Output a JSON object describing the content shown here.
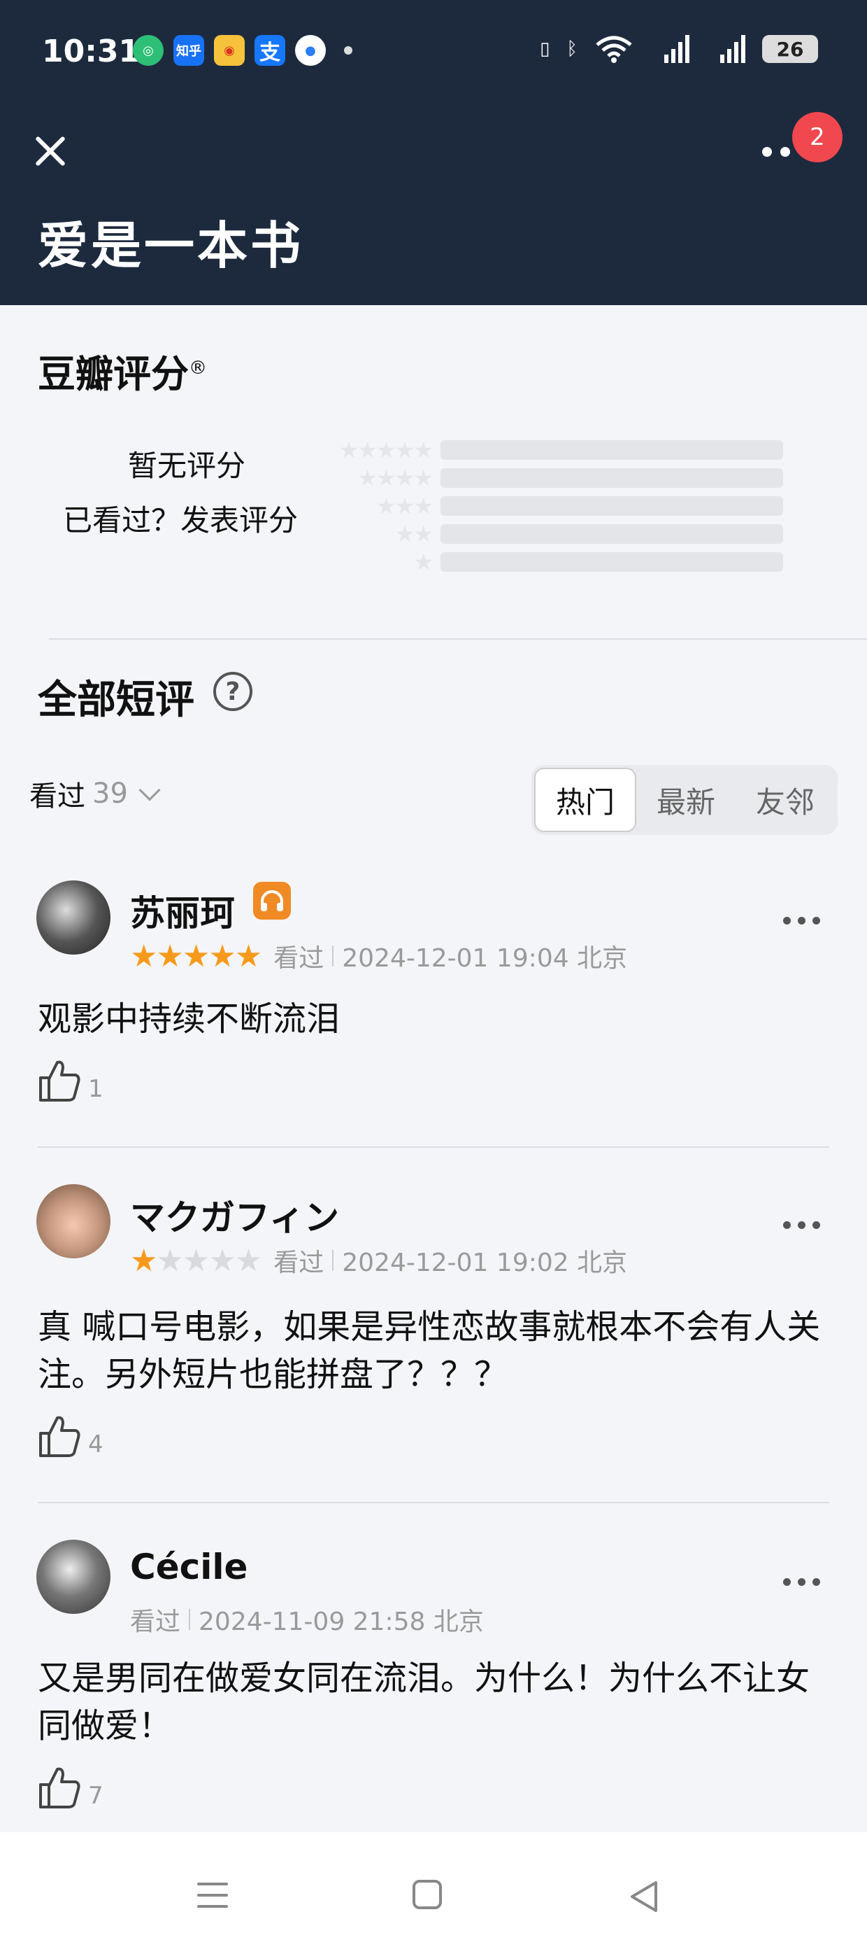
{
  "status": {
    "time": "10:31",
    "apps": [
      "wechat-icon",
      "zhihu-icon",
      "weibo-icon",
      "alipay-icon",
      "browser-icon"
    ],
    "zhihu_label": "知乎",
    "alipay_label": "支",
    "battery": "26"
  },
  "header": {
    "title": "爱是一本书",
    "badge_count": "2"
  },
  "rating": {
    "title": "豆瓣评分",
    "registered": "®",
    "no_rating": "暂无评分",
    "post_prompt": "已看过？发表评分",
    "distribution": [
      {
        "stars": "★★★★★",
        "value": 0
      },
      {
        "stars": "★★★★",
        "value": 0
      },
      {
        "stars": "★★★",
        "value": 0
      },
      {
        "stars": "★★",
        "value": 0
      },
      {
        "stars": "★",
        "value": 0
      }
    ]
  },
  "comments_section": {
    "title": "全部短评",
    "help": "?",
    "filter_label": "看过",
    "filter_count": "39",
    "tabs": [
      "热门",
      "最新",
      "友邻"
    ],
    "active_tab": "热门"
  },
  "comments": [
    {
      "user": "苏丽珂",
      "rating": 5,
      "stars_on": "★★★★★",
      "stars_off": "",
      "status": "看过",
      "datetime": "2024-12-01 19:04 北京",
      "text": "观影中持续不断流泪",
      "likes": "1"
    },
    {
      "user": "マクガフィン",
      "rating": 1,
      "stars_on": "★",
      "stars_off": "★★★★",
      "status": "看过",
      "datetime": "2024-12-01 19:02 北京",
      "text": "真 喊口号电影，如果是异性恋故事就根本不会有人关注。另外短片也能拼盘了？？？",
      "likes": "4"
    },
    {
      "user": "Cécile",
      "rating": 0,
      "status": "看过",
      "datetime": "2024-11-09 21:58 北京",
      "text": "又是男同在做爱女同在流泪。为什么！为什么不让女同做爱！",
      "likes": "7"
    }
  ]
}
